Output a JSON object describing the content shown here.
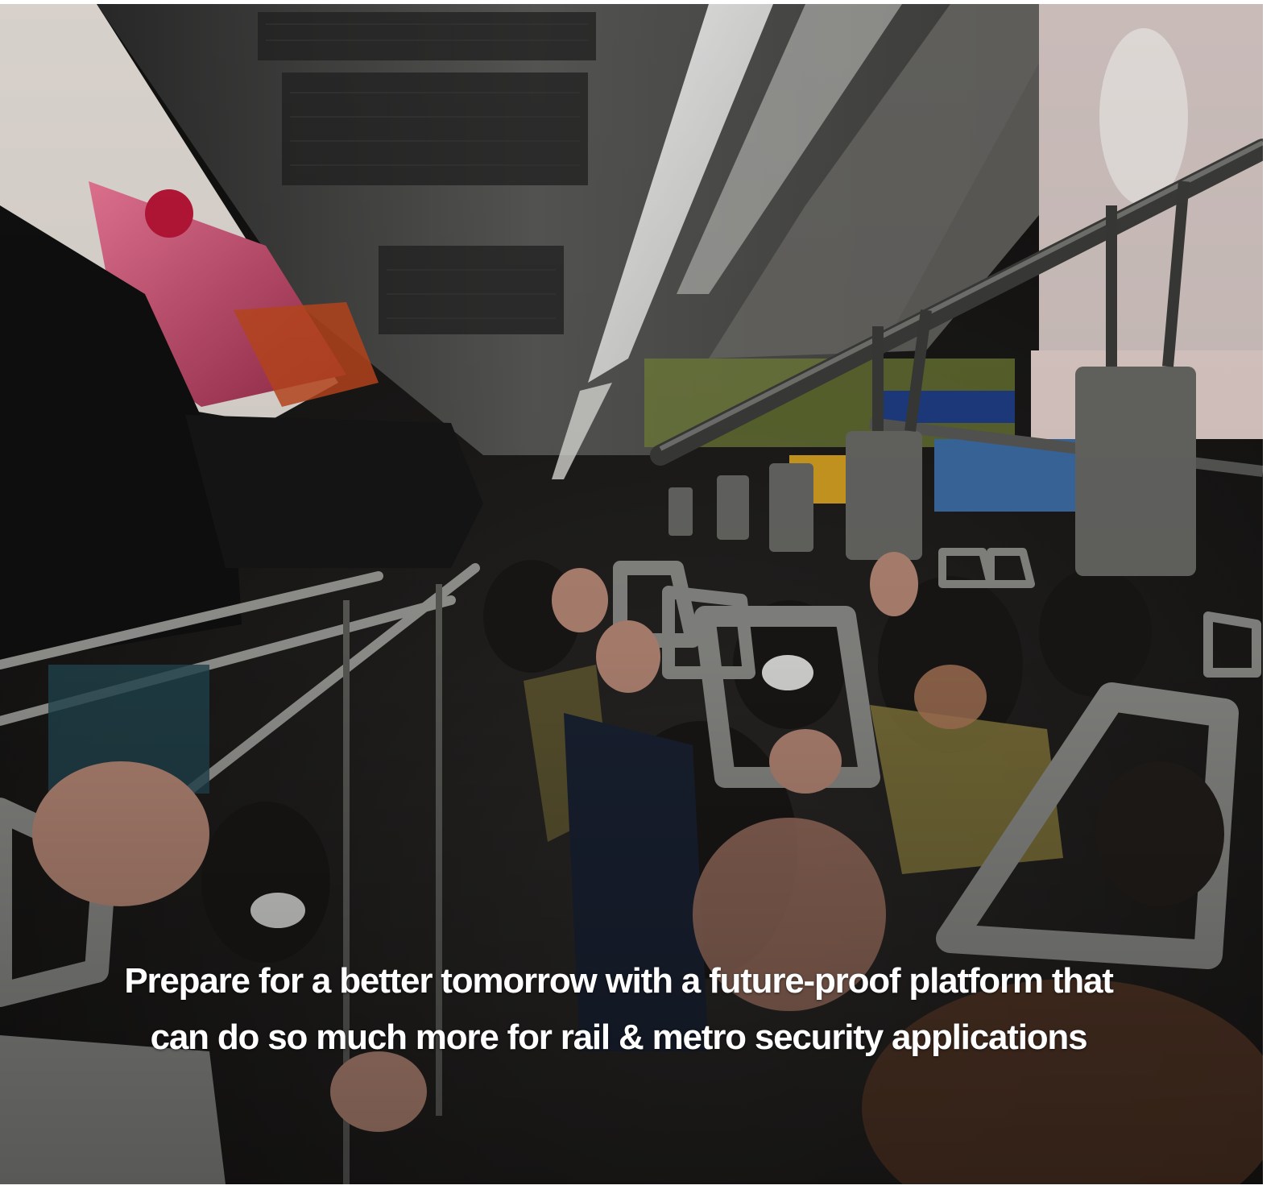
{
  "hero": {
    "image_subject": "crowded-metro-carriage-photo",
    "headline": "Prepare for a better tomorrow with a future-proof platform that can do so much more for rail & metro security applications",
    "headline_color": "#ffffff"
  }
}
